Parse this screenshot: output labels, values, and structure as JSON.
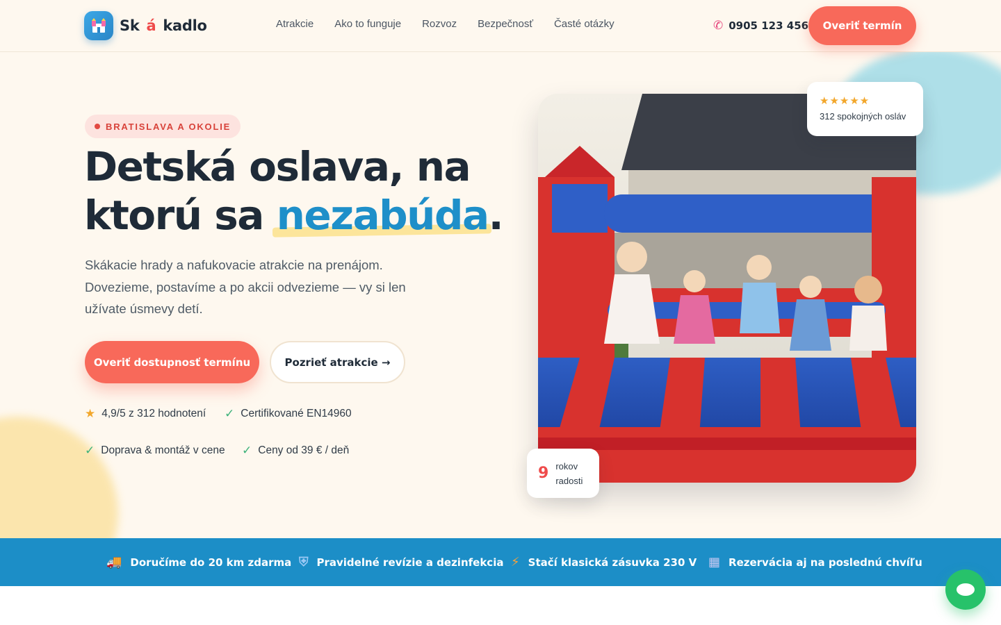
{
  "header": {
    "logo_text_a": "Sk",
    "logo_text_accent": "á",
    "logo_text_b": "kadlo",
    "nav": [
      "Atrakcie",
      "Ako to funguje",
      "Rozvoz",
      "Bezpečnosť",
      "Časté otázky"
    ],
    "phone": "0905 123 456",
    "cta": "Overiť termín"
  },
  "hero": {
    "pill": "BRATISLAVA A OKOLIE",
    "headline_line1": "Detská oslava, na",
    "headline_line2_a": "ktorú sa",
    "headline_highlight": "nezabúda",
    "headline_dot": ".",
    "lead": "Skákacie hrady a nafukovacie atrakcie na prenájom. Dovezieme, postavíme a po akcii odvezieme — vy si len užívate úsmevy detí.",
    "cta_primary": "Overiť dostupnosť termínu",
    "cta_secondary": "Pozrieť atrakcie →",
    "features": [
      {
        "icon": "star-icon",
        "text": "4,9/5 z 312 hodnotení"
      },
      {
        "icon": "check-icon",
        "text": "Certifikované EN14960"
      },
      {
        "icon": "check-icon",
        "text": "Doprava & montáž v cene"
      },
      {
        "icon": "check-icon",
        "text": "Ceny od 39 € / deň"
      }
    ]
  },
  "rating_card": {
    "stars": "★★★★★",
    "text": "312 spokojných osláv"
  },
  "years_card": {
    "number": "9",
    "label": "rokov radosti"
  },
  "strip": [
    {
      "icon": "truck-icon",
      "text": "Doručíme do 20 km zdarma"
    },
    {
      "icon": "shield-icon",
      "text": "Pravidelné revízie a dezinfekcia"
    },
    {
      "icon": "bolt-icon",
      "text": "Stačí klasická zásuvka 230 V"
    },
    {
      "icon": "calendar-icon",
      "text": "Rezervácia aj na poslednú chvíľu"
    }
  ],
  "colors": {
    "accent_coral": "#f8695a",
    "accent_blue": "#1c8ec7",
    "background": "#fef8ef",
    "chat_green": "#27c26a"
  }
}
